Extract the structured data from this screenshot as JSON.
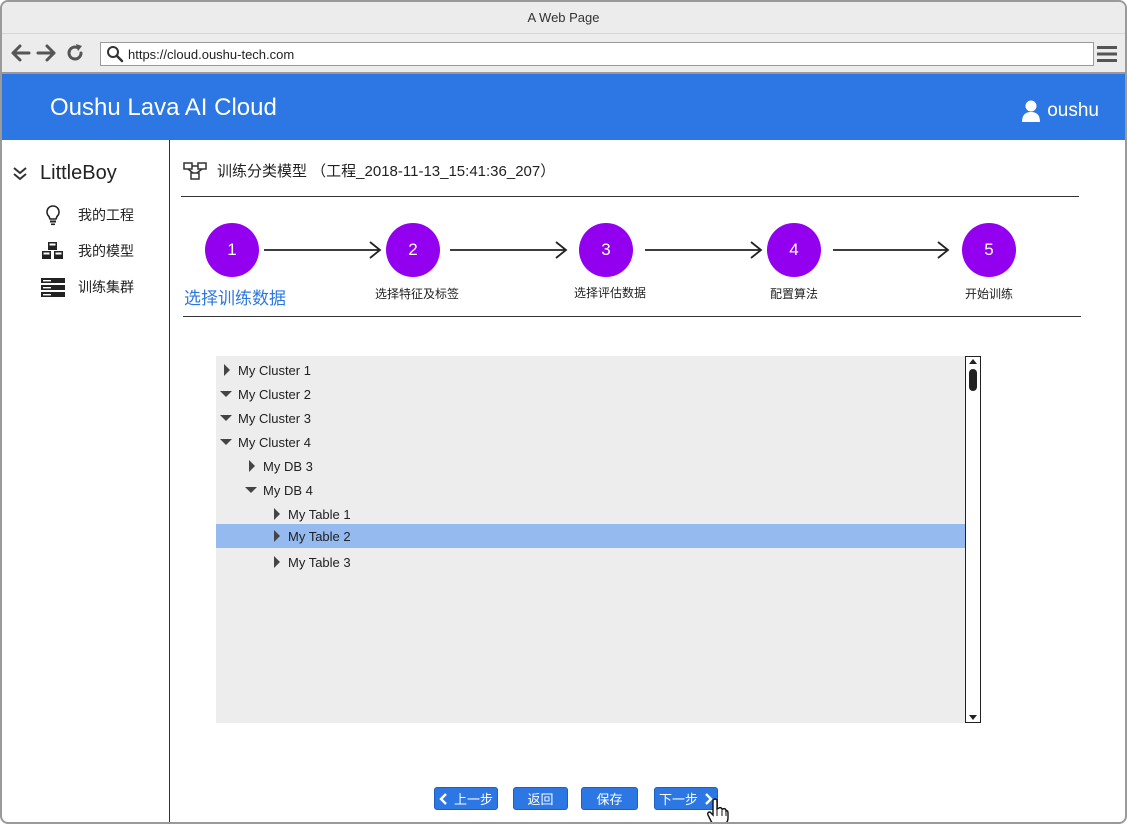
{
  "browser": {
    "window_title": "A Web Page",
    "url": "https://cloud.oushu-tech.com"
  },
  "header": {
    "app_title": "Oushu Lava AI Cloud",
    "username": "oushu"
  },
  "sidebar": {
    "title": "LittleBoy",
    "items": [
      {
        "label": "我的工程",
        "icon": "lightbulb-icon"
      },
      {
        "label": "我的模型",
        "icon": "cubes-icon"
      },
      {
        "label": "训练集群",
        "icon": "server-icon"
      }
    ]
  },
  "main": {
    "page_title": "训练分类模型 （工程_2018-11-13_15:41:36_207）",
    "steps": [
      {
        "number": "1",
        "label": "选择训练数据",
        "active": true
      },
      {
        "number": "2",
        "label": "选择特征及标签"
      },
      {
        "number": "3",
        "label": "选择评估数据"
      },
      {
        "number": "4",
        "label": "配置算法"
      },
      {
        "number": "5",
        "label": "开始训练"
      }
    ],
    "tree": [
      {
        "label": "My Cluster 1",
        "expanded": false
      },
      {
        "label": "My Cluster 2",
        "expanded": true
      },
      {
        "label": "My Cluster 3",
        "expanded": true
      },
      {
        "label": "My Cluster 4",
        "expanded": true
      },
      {
        "label": "My DB 3",
        "expanded": false
      },
      {
        "label": "My DB 4",
        "expanded": true
      },
      {
        "label": "My Table 1",
        "expanded": false
      },
      {
        "label": "My Table 2",
        "expanded": false,
        "selected": true
      },
      {
        "label": "My Table 3",
        "expanded": false
      }
    ]
  },
  "buttons": {
    "prev": "上一步",
    "back": "返回",
    "save": "保存",
    "next": "下一步"
  },
  "colors": {
    "brand": "#2c77e3",
    "step": "#9300f0",
    "selected_row": "#94baf0"
  }
}
